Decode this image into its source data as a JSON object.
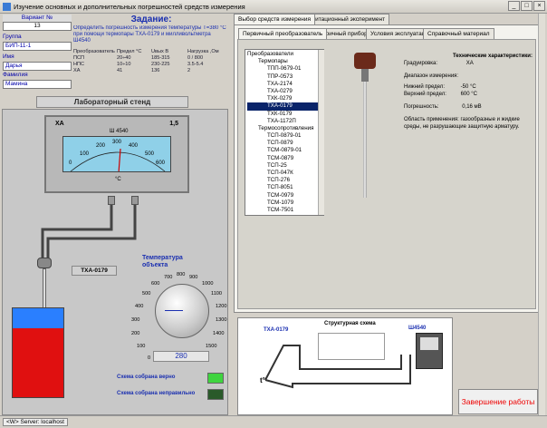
{
  "window": {
    "title": "Изучение основных и дополнительных погрешностей средств измерения",
    "buttons": [
      "_",
      "□",
      "×"
    ]
  },
  "left": {
    "variant_label": "Вариант №",
    "variant_value": "13",
    "group_label": "Группа",
    "group_value": "БИП-11-1",
    "name_label": "Имя",
    "name_value": "Дарья",
    "surname_label": "Фамилия",
    "surname_value": "Мамина",
    "task_title": "Задание:",
    "task_text": "Определить погрешность измерения температуры T=380 °С при помощи термопары ТХА-0179 и милливольтметра Ш4540",
    "table_headers": [
      "Преобразователь",
      "Предел °С",
      "Uвых В",
      "Нагрузка ,Ом"
    ],
    "table_rows": [
      [
        "ПСП",
        "20÷40",
        "185-315",
        "0 / 800"
      ],
      [
        "НПС",
        "10÷10",
        "230-225",
        "3.5-5.4"
      ],
      [
        "ХА",
        "41",
        "136",
        "2"
      ]
    ]
  },
  "stand": {
    "title": "Лабораторный стенд",
    "meter_type": "ХА",
    "meter_model": "Ш 4540",
    "meter_class": "1,5",
    "meter_unit": "°С",
    "scale_labels": [
      "0",
      "100",
      "200",
      "300",
      "400",
      "500",
      "600"
    ],
    "sensor_label": "ТХА-0179",
    "object_temp_title": "Температура объекта",
    "dial_labels": [
      "0",
      "100",
      "200",
      "300",
      "400",
      "500",
      "600",
      "700",
      "800",
      "900",
      "1000",
      "1100",
      "1200",
      "1300",
      "1400",
      "1500"
    ],
    "temp_value": "280",
    "ok_label": "Схема собрана верно",
    "bad_label": "Схема собрана неправильно"
  },
  "tabs_top": [
    "Выбор средств измерения",
    "Имитационный эксперимент"
  ],
  "tabs_inner": [
    "Первичный преобразователь",
    "Вторичный прибор",
    "Условия эксплуатации",
    "Справочный материал"
  ],
  "tree": {
    "root": "Преобразователи",
    "groups": [
      {
        "name": "Термопары",
        "items": [
          "ТПП-0679-01",
          "ТПР-0573",
          "ТХА-2174",
          "ТХА-0279",
          "ТХК-0279",
          "ТХА-0179",
          "ТХК-0179",
          "ТХА-1172П"
        ]
      },
      {
        "name": "Термосопротивления",
        "items": [
          "ТСП-0879-01",
          "ТСП-0879",
          "ТСМ-0879-01",
          "ТСМ-0879",
          "ТСП-25",
          "ТСП-047К",
          "ТСП-276",
          "ТСП-8051",
          "ТСМ-0979",
          "ТСМ-1079",
          "ТСМ-7501"
        ]
      }
    ],
    "selected": "ТХА-0179"
  },
  "spec": {
    "title": "Технические характеристики:",
    "grad_label": "Градуировка:",
    "grad_value": "ХА",
    "range_label": "Диапазон измерения:",
    "low_label": "Нижний предел:",
    "low_value": "-50 °С",
    "high_label": "Верхний предел:",
    "high_value": "600 °С",
    "err_label": "Погрешность:",
    "err_value": "0,16 мВ",
    "app_text": "Область применения: газообразные и жидкие среды, не разрушающие защитную арматуру."
  },
  "scheme": {
    "title": "Структурная схема",
    "left_label": "ТХА-0179",
    "right_label": "Ш4540",
    "t_label": "t°"
  },
  "finish_button": "Завершение работы",
  "status": {
    "server": "<W> Server: localhost"
  }
}
